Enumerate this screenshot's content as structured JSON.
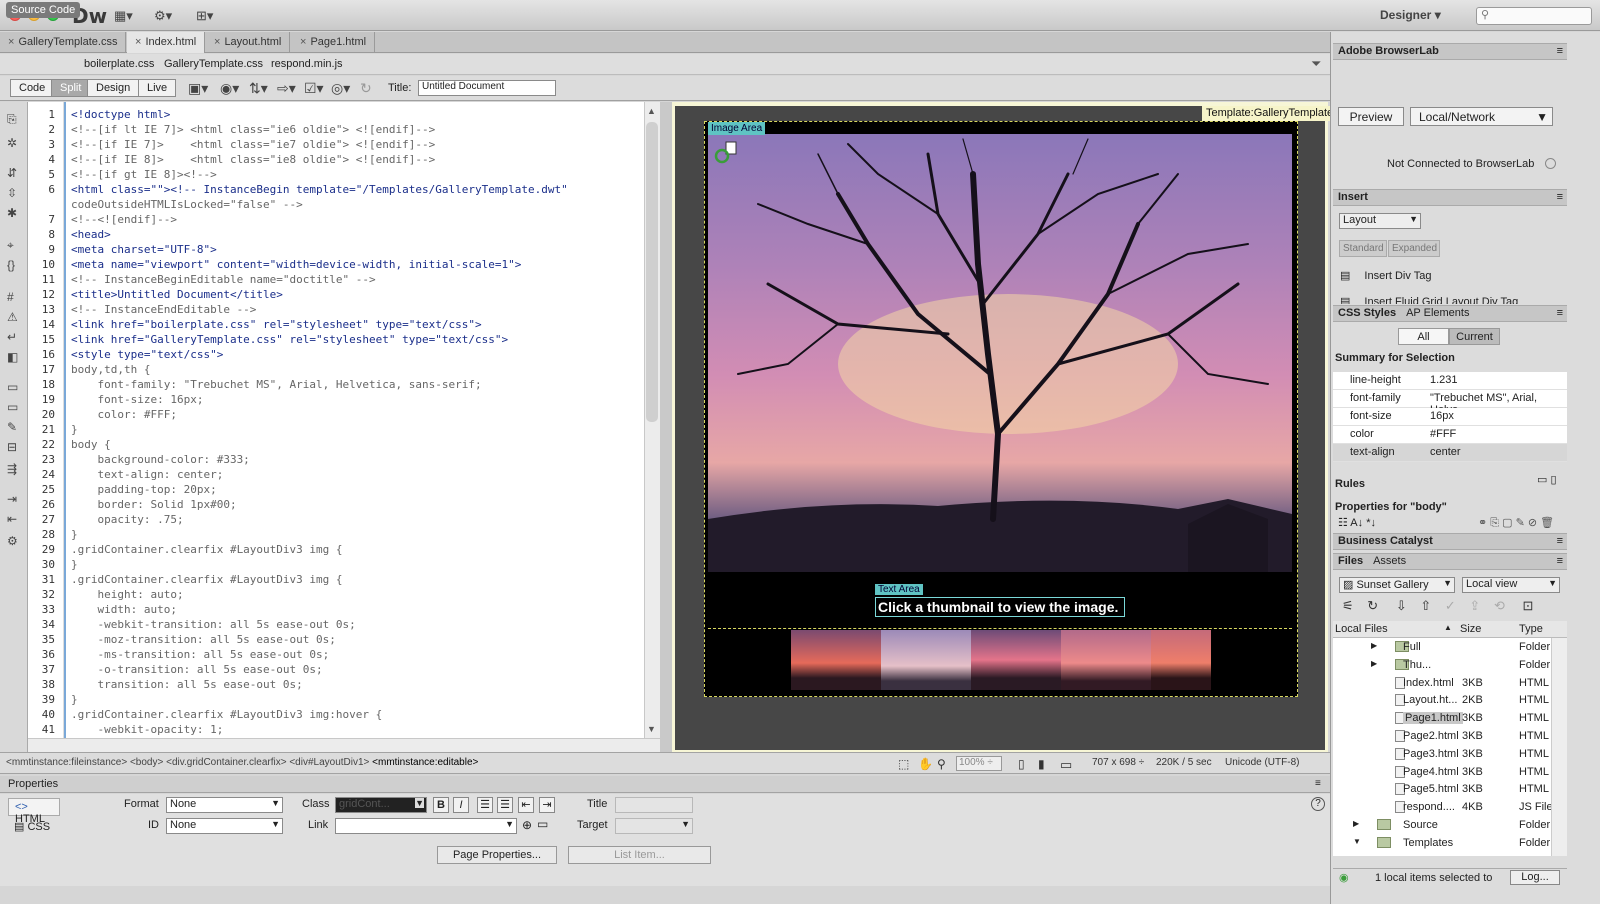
{
  "app": {
    "logo": "Dw",
    "workspace": "Designer",
    "search_placeholder": ""
  },
  "tabs": [
    {
      "label": "GalleryTemplate.css",
      "close": "×"
    },
    {
      "label": "Index.html",
      "close": "×"
    },
    {
      "label": "Layout.html",
      "close": "×"
    },
    {
      "label": "Page1.html",
      "close": "×"
    }
  ],
  "related": {
    "source": "Source Code",
    "files": [
      "boilerplate.css",
      "GalleryTemplate.css",
      "respond.min.js"
    ]
  },
  "view_buttons": [
    "Code",
    "Split",
    "Design",
    "Live"
  ],
  "title_label": "Title:",
  "title_value": "Untitled Document",
  "code_lines": [
    "<!doctype html>",
    "<!--[if lt IE 7]> <html class=\"ie6 oldie\"> <![endif]-->",
    "<!--[if IE 7]>    <html class=\"ie7 oldie\"> <![endif]-->",
    "<!--[if IE 8]>    <html class=\"ie8 oldie\"> <![endif]-->",
    "<!--[if gt IE 8]><!-->",
    "<html class=\"\"><!-- InstanceBegin template=\"/Templates/GalleryTemplate.dwt\"",
    "codeOutsideHTMLIsLocked=\"false\" -->",
    "<!--<![endif]-->",
    "<head>",
    "<meta charset=\"UTF-8\">",
    "<meta name=\"viewport\" content=\"width=device-width, initial-scale=1\">",
    "<!-- InstanceBeginEditable name=\"doctitle\" -->",
    "<title>Untitled Document</title>",
    "<!-- InstanceEndEditable -->",
    "<link href=\"boilerplate.css\" rel=\"stylesheet\" type=\"text/css\">",
    "<link href=\"GalleryTemplate.css\" rel=\"stylesheet\" type=\"text/css\">",
    "<style type=\"text/css\">",
    "body,td,th {",
    "    font-family: \"Trebuchet MS\", Arial, Helvetica, sans-serif;",
    "    font-size: 16px;",
    "    color: #FFF;",
    "}",
    "body {",
    "    background-color: #333;",
    "    text-align: center;",
    "    padding-top: 20px;",
    "    border: Solid 1px#00;",
    "    opacity: .75;",
    "}",
    ".gridContainer.clearfix #LayoutDiv3 img {",
    "}",
    ".gridContainer.clearfix #LayoutDiv3 img {",
    "    height: auto;",
    "    width: auto;",
    "    -webkit-transition: all 5s ease-out 0s;",
    "    -moz-transition: all 5s ease-out 0s;",
    "    -ms-transition: all 5s ease-out 0s;",
    "    -o-transition: all 5s ease-out 0s;",
    "    transition: all 5s ease-out 0s;",
    "}",
    ".gridContainer.clearfix #LayoutDiv3 img:hover {",
    "    -webkit-opacity: 1;"
  ],
  "line_numbers": [
    "1",
    "2",
    "3",
    "4",
    "5",
    "6",
    "",
    "7",
    "8",
    "9",
    "10",
    "11",
    "12",
    "13",
    "14",
    "15",
    "16",
    "17",
    "18",
    "19",
    "20",
    "21",
    "22",
    "23",
    "24",
    "25",
    "26",
    "27",
    "28",
    "29",
    "30",
    "31",
    "32",
    "33",
    "34",
    "35",
    "36",
    "37",
    "38",
    "39",
    "40",
    "41"
  ],
  "design": {
    "template_label": "Template:GalleryTemplate",
    "image_area": "Image Area",
    "text_area": "Text Area",
    "caption": "Click a thumbnail to view the image."
  },
  "status": {
    "tags": [
      "<mmtinstance:fileinstance>",
      "<body>",
      "<div.gridContainer.clearfix>",
      "<div#LayoutDiv1>"
    ],
    "current_tag": "<mmtinstance:editable>",
    "zoom": "100%",
    "size": "707 x 698",
    "download": "220K / 5 sec",
    "encoding": "Unicode (UTF-8)"
  },
  "properties": {
    "title": "Properties",
    "html": "HTML",
    "css": "CSS",
    "format_label": "Format",
    "format_value": "None",
    "id_label": "ID",
    "id_value": "None",
    "class_label": "Class",
    "class_value": "gridCont...",
    "link_label": "Link",
    "title_label": "Title",
    "target_label": "Target",
    "page_props": "Page Properties...",
    "list_item": "List Item...",
    "bold": "B",
    "italic": "I"
  },
  "browserlab": {
    "title": "Adobe BrowserLab",
    "preview": "Preview",
    "mode": "Local/Network",
    "status": "Not Connected to BrowserLab"
  },
  "insert": {
    "title": "Insert",
    "category": "Layout",
    "standard": "Standard",
    "expanded": "Expanded",
    "items": [
      "Insert Div Tag",
      "Insert Fluid Grid Layout Div Tag"
    ]
  },
  "css_styles": {
    "tab1": "CSS Styles",
    "tab2": "AP Elements",
    "all": "All",
    "current": "Current",
    "summary": "Summary for Selection",
    "props": [
      {
        "name": "line-height",
        "value": "1.231"
      },
      {
        "name": "font-family",
        "value": "\"Trebuchet MS\", Arial, Helve..."
      },
      {
        "name": "font-size",
        "value": "16px"
      },
      {
        "name": "color",
        "value": "#FFF"
      },
      {
        "name": "text-align",
        "value": "center"
      }
    ],
    "rules": "Rules",
    "props_for": "Properties for \"body\""
  },
  "business_catalyst": "Business Catalyst",
  "files": {
    "tab1": "Files",
    "tab2": "Assets",
    "site": "Sunset Gallery",
    "view": "Local view",
    "col_name": "Local Files",
    "col_size": "Size",
    "col_type": "Type",
    "rows": [
      {
        "name": "Full",
        "size": "",
        "type": "Folder",
        "kind": "folder"
      },
      {
        "name": "Thu...",
        "size": "",
        "type": "Folder",
        "kind": "folder"
      },
      {
        "name": "Index.html",
        "size": "3KB",
        "type": "HTML Fi",
        "kind": "file"
      },
      {
        "name": "Layout.ht...",
        "size": "2KB",
        "type": "HTML Fi",
        "kind": "file"
      },
      {
        "name": "Page1.html",
        "size": "3KB",
        "type": "HTML Fi",
        "kind": "file"
      },
      {
        "name": "Page2.html",
        "size": "3KB",
        "type": "HTML Fi",
        "kind": "file"
      },
      {
        "name": "Page3.html",
        "size": "3KB",
        "type": "HTML Fi",
        "kind": "file"
      },
      {
        "name": "Page4.html",
        "size": "3KB",
        "type": "HTML Fi",
        "kind": "file"
      },
      {
        "name": "Page5.html",
        "size": "3KB",
        "type": "HTML Fi",
        "kind": "file"
      },
      {
        "name": "respond....",
        "size": "4KB",
        "type": "JS File",
        "kind": "file"
      },
      {
        "name": "Source",
        "size": "",
        "type": "Folder",
        "kind": "folder"
      },
      {
        "name": "Templates",
        "size": "",
        "type": "Folder",
        "kind": "folder"
      }
    ],
    "status": "1 local items selected to",
    "log": "Log..."
  }
}
